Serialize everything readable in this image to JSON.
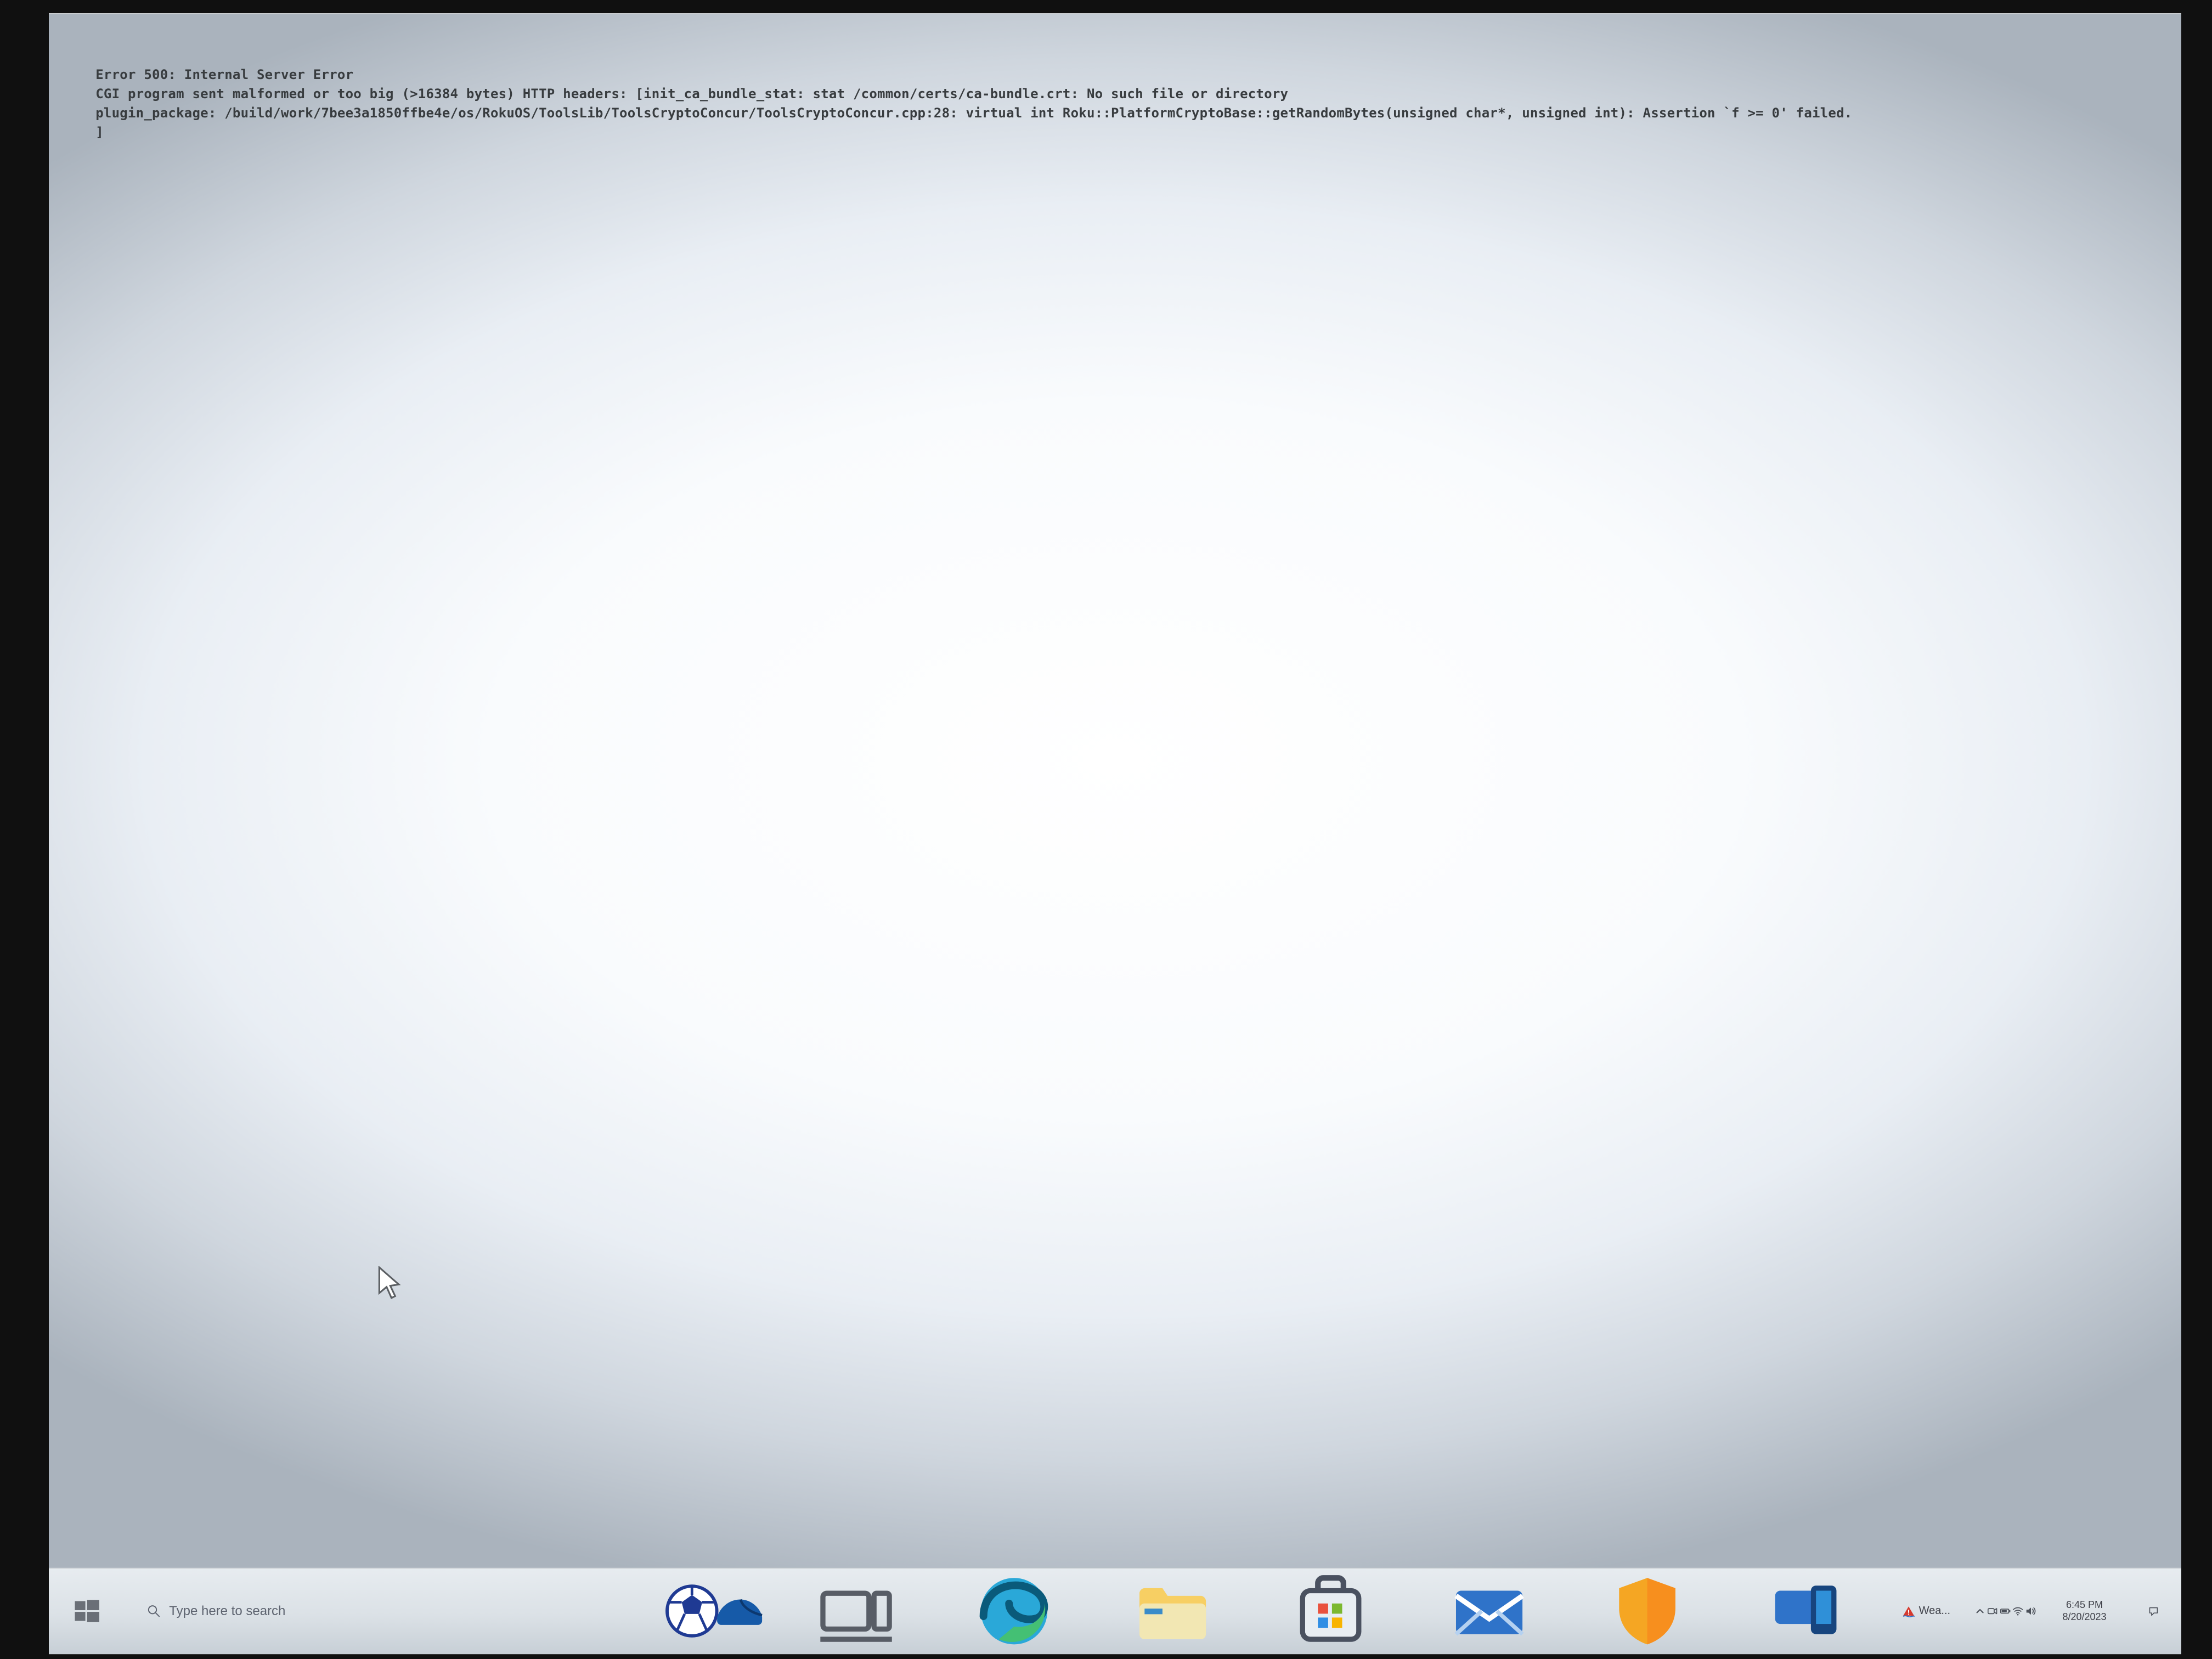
{
  "error": {
    "lines": [
      "Error 500: Internal Server Error",
      "CGI program sent malformed or too big (>16384 bytes) HTTP headers: [init_ca_bundle_stat: stat /common/certs/ca-bundle.crt: No such file or directory",
      "plugin_package: /build/work/7bee3a1850ffbe4e/os/RokuOS/ToolsLib/ToolsCryptoConcur/ToolsCryptoConcur.cpp:28: virtual int Roku::PlatformCryptoBase::getRandomBytes(unsigned char*, unsigned int): Assertion `f >= 0' failed.",
      "]"
    ]
  },
  "taskbar": {
    "search_placeholder": "Type here to search",
    "weather_label": "Wea...",
    "time": "6:45 PM",
    "date": "8/20/2023"
  }
}
